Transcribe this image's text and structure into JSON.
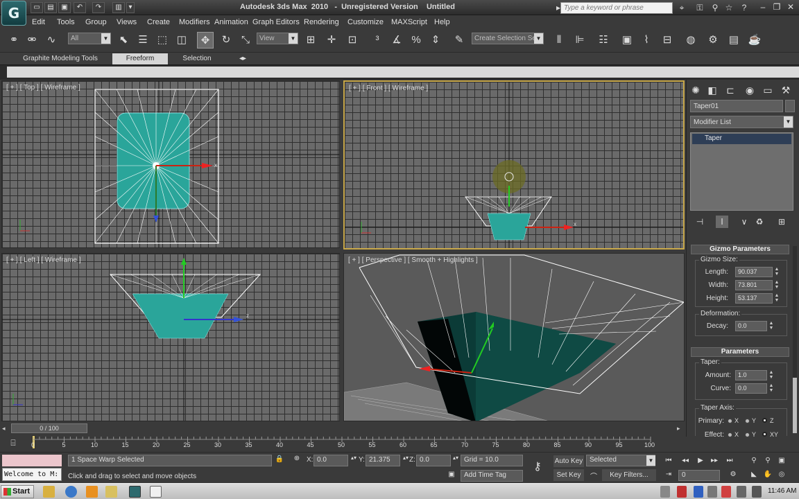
{
  "titlebar": {
    "logo": "G",
    "title": "Autodesk 3ds Max  2010   -  Unregistered Version    Untitled",
    "search_placeholder": "Type a keyword or phrase",
    "quick_access": [
      "new-icon",
      "open-icon",
      "save-icon",
      "undo-icon",
      "redo-icon",
      "project-icon"
    ],
    "help_icons": [
      "binoculars-icon",
      "key-icon",
      "favorites-icon",
      "help-icon"
    ],
    "window_controls": [
      "minimize-icon",
      "restore-icon",
      "close-icon"
    ]
  },
  "menu": {
    "items": [
      "Edit",
      "Tools",
      "Group",
      "Views",
      "Create",
      "Modifiers",
      "Animation",
      "Graph Editors",
      "Rendering",
      "Customize",
      "MAXScript",
      "Help"
    ]
  },
  "toolbar": {
    "selection_filter": "All",
    "reference_coord": "View",
    "named_selection": "Create Selection Se",
    "active_tool": "select-move-icon"
  },
  "ribbon": {
    "tabs": [
      "Graphite Modeling Tools",
      "Freeform",
      "Selection"
    ],
    "active_tab": "Freeform"
  },
  "viewports": {
    "top": "[ + ] [ Top ] [ Wireframe ]",
    "front": "[ + ] [ Front ] [ Wireframe ]",
    "left": "[ + ] [ Left ] [ Wireframe ]",
    "perspective": "[ + ] [ Perspective ] [ Smooth + Highlights ]",
    "active": "front",
    "axis_labels": {
      "top_x": "x",
      "front_x": "x",
      "left_z": "z"
    }
  },
  "command_panel": {
    "object_name": "Taper01",
    "modifier_list": "Modifier List",
    "stack": [
      "Taper"
    ],
    "gizmo_header": "Gizmo Parameters",
    "gizmo_size_label": "Gizmo Size:",
    "length_label": "Length:",
    "length": "90.037",
    "width_label": "Width:",
    "width": "73.801",
    "height_label": "Height:",
    "height": "53.137",
    "deformation_label": "Deformation:",
    "decay_label": "Decay:",
    "decay": "0.0",
    "params_header": "Parameters",
    "taper_label": "Taper:",
    "amount_label": "Amount:",
    "amount": "1.0",
    "curve_label": "Curve:",
    "curve": "0.0",
    "taper_axis_label": "Taper Axis:",
    "primary_label": "Primary:",
    "effect_label": "Effect:",
    "primary_options": [
      "X",
      "Y",
      "Z"
    ],
    "primary_selected": "Z",
    "effect_options": [
      "X",
      "Y",
      "XY"
    ],
    "effect_selected": "XY"
  },
  "timeline": {
    "position": "0 / 100",
    "ticks": [
      "0",
      "5",
      "10",
      "15",
      "20",
      "25",
      "30",
      "35",
      "40",
      "45",
      "50",
      "55",
      "60",
      "65",
      "70",
      "75",
      "80",
      "85",
      "90",
      "95",
      "100"
    ]
  },
  "status": {
    "maxscript_text": "Welcome to M:",
    "selection_info": "1 Space Warp Selected",
    "prompt": "Click and drag to select and move objects",
    "x_label": "X:",
    "x": "0.0",
    "y_label": "Y:",
    "y": "21.375",
    "z_label": "Z:",
    "z": "0.0",
    "grid": "Grid = 10.0",
    "add_time_tag": "Add Time Tag",
    "auto_key": "Auto Key",
    "set_key": "Set Key",
    "key_mode": "Selected",
    "key_filters": "Key Filters...",
    "frame": "0"
  },
  "taskbar": {
    "start": "Start",
    "clock": "11:46 AM"
  }
}
